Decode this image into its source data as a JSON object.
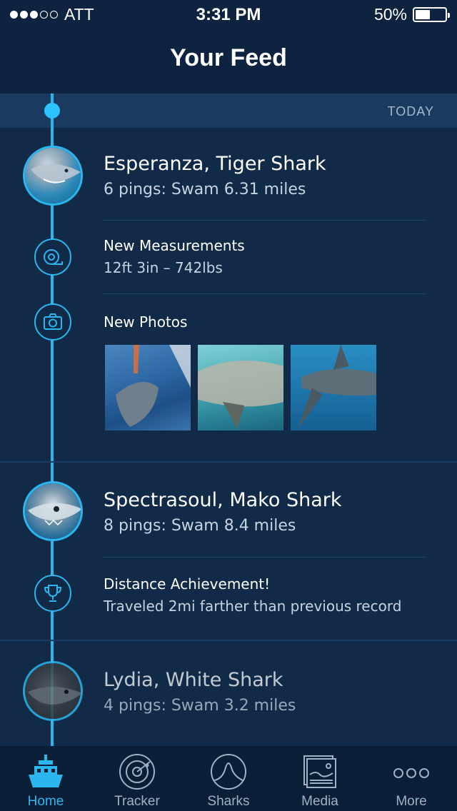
{
  "status_bar": {
    "carrier": "ATT",
    "time": "3:31 PM",
    "battery": "50%",
    "battery_level": 0.5,
    "signal_bars": 3,
    "signal_total": 5
  },
  "header": {
    "title": "Your Feed"
  },
  "feed": {
    "date_label": "TODAY",
    "sharks": [
      {
        "name": "Esperanza, Tiger Shark",
        "summary": "6 pings: Swam 6.31 miles",
        "entries": [
          {
            "icon": "tape-measure-icon",
            "title": "New Measurements",
            "detail": "12ft 3in – 742lbs"
          },
          {
            "icon": "camera-icon",
            "title": "New Photos"
          }
        ]
      },
      {
        "name": "Spectrasoul, Mako Shark",
        "summary": "8 pings: Swam 8.4 miles",
        "entries": [
          {
            "icon": "trophy-icon",
            "title": "Distance Achievement!",
            "detail": "Traveled 2mi farther than previous record"
          }
        ]
      },
      {
        "name": "Lydia, White Shark",
        "summary": "4 pings: Swam 3.2 miles"
      }
    ]
  },
  "tab_bar": {
    "tabs": [
      {
        "label": "Home",
        "icon": "boat-icon",
        "active": true
      },
      {
        "label": "Tracker",
        "icon": "radar-icon",
        "active": false
      },
      {
        "label": "Sharks",
        "icon": "shark-fin-icon",
        "active": false
      },
      {
        "label": "Media",
        "icon": "media-icon",
        "active": false
      },
      {
        "label": "More",
        "icon": "more-icon",
        "active": false
      }
    ]
  },
  "colors": {
    "accent": "#2bb6ee",
    "background": "#112a47",
    "bar_background": "#0d2340"
  }
}
